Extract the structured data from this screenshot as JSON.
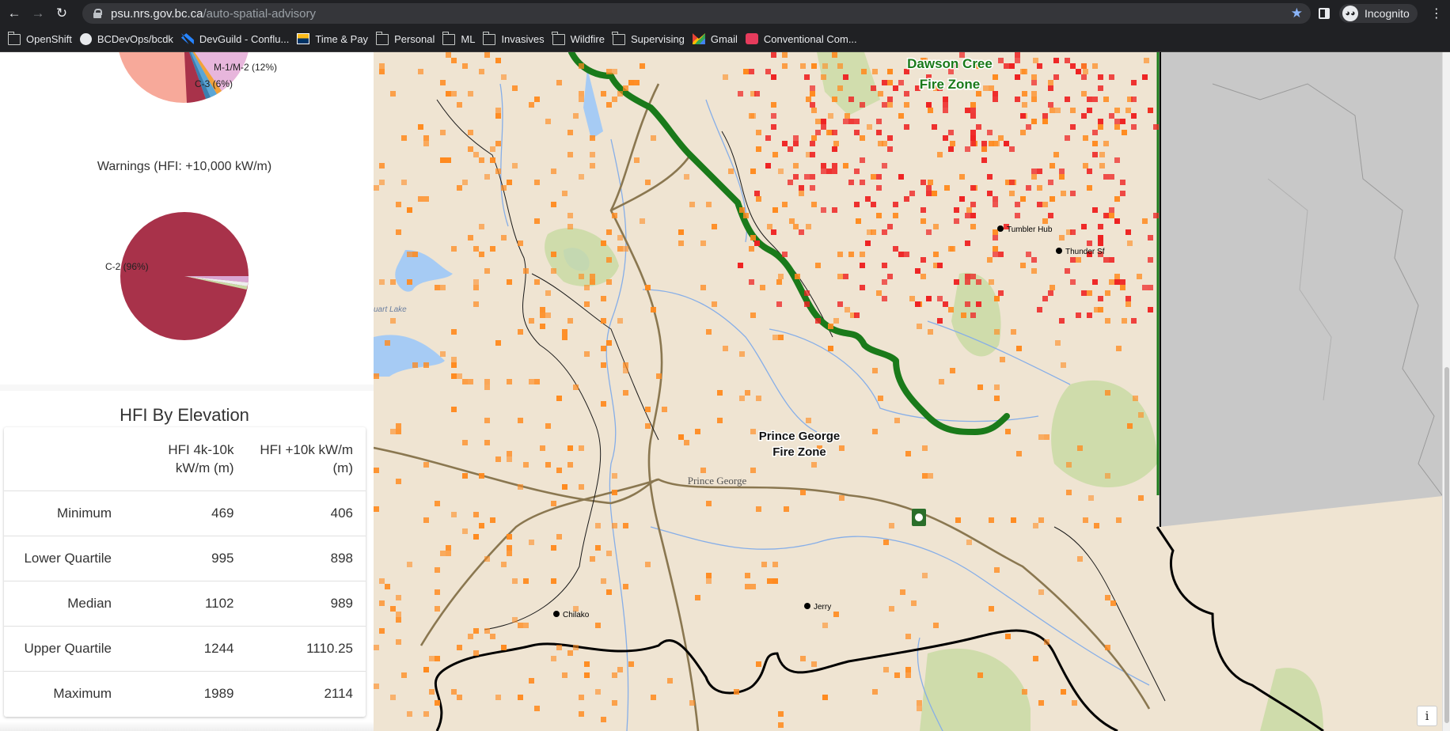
{
  "browser": {
    "url_host": "psu.nrs.gov.bc.ca",
    "url_path": "/auto-spatial-advisory",
    "profile_label": "Incognito"
  },
  "bookmarks": [
    {
      "label": "OpenShift",
      "icon": "openshift-icon"
    },
    {
      "label": "BCDevOps/bcdk",
      "icon": "github-icon"
    },
    {
      "label": "DevGuild - Conflu...",
      "icon": "confluence-icon"
    },
    {
      "label": "Time & Pay",
      "icon": "bcgov-icon"
    },
    {
      "label": "Personal",
      "icon": "folder-icon"
    },
    {
      "label": "ML",
      "icon": "folder-icon"
    },
    {
      "label": "Invasives",
      "icon": "folder-icon"
    },
    {
      "label": "Wildfire",
      "icon": "folder-icon"
    },
    {
      "label": "Supervising",
      "icon": "folder-icon"
    },
    {
      "label": "Gmail",
      "icon": "gmail-icon"
    },
    {
      "label": "Conventional Com...",
      "icon": "bookmark-icon"
    }
  ],
  "advisory_pie": {
    "labels": [
      "M-1/M-2 (12%)",
      "C-3 (6%)"
    ]
  },
  "warnings": {
    "title": "Warnings (HFI: +10,000 kW/m)",
    "pie_label": "C-2 (96%)"
  },
  "elevation": {
    "title": "HFI By Elevation",
    "col1": "HFI 4k-10k kW/m (m)",
    "col2": "HFI +10k kW/m (m)",
    "rows": [
      {
        "label": "Minimum",
        "v1": "469",
        "v2": "406"
      },
      {
        "label": "Lower Quartile",
        "v1": "995",
        "v2": "898"
      },
      {
        "label": "Median",
        "v1": "1102",
        "v2": "989"
      },
      {
        "label": "Upper Quartile",
        "v1": "1244",
        "v2": "1110.25"
      },
      {
        "label": "Maximum",
        "v1": "1989",
        "v2": "2114"
      }
    ]
  },
  "map": {
    "zone_pg_line1": "Prince George",
    "zone_pg_line2": "Fire Zone",
    "zone_dc_line1": "Dawson Cree",
    "zone_dc_line2": "Fire Zone",
    "city_label": "Prince George",
    "lake_label": "uart Lake",
    "stations": [
      "Tumbler Hub",
      "Thunder Sf",
      "Chilako",
      "Jerry"
    ],
    "info_label": "i",
    "colors": {
      "advisory": "#ff8a1e",
      "warning": "#ee2222",
      "zone_border": "#1a7a1a",
      "water": "#a6cbf4",
      "park": "#c9dba4"
    }
  }
}
